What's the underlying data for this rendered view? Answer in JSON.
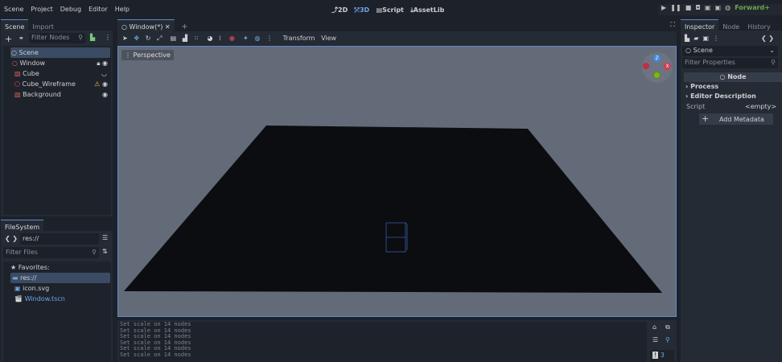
{
  "menu": [
    "Scene",
    "Project",
    "Debug",
    "Editor",
    "Help"
  ],
  "modes": [
    {
      "label": "2D",
      "icon": "2d-icon"
    },
    {
      "label": "3D",
      "icon": "3d-icon",
      "active": true
    },
    {
      "label": "Script",
      "icon": "script-icon"
    },
    {
      "label": "AssetLib",
      "icon": "download-icon"
    }
  ],
  "renderer": "Forward+",
  "scene_dock": {
    "tabs": [
      "Scene",
      "Import"
    ],
    "filter_placeholder": "Filter Nodes",
    "tree": [
      {
        "label": "Scene",
        "icon": "node-icon",
        "selected": true
      },
      {
        "label": "Window",
        "icon": "node-icon",
        "extra": [
          "lock-icon",
          "eye-icon"
        ]
      },
      {
        "label": "Cube",
        "icon": "mesh-icon",
        "extra": [
          "eye-closed-icon"
        ]
      },
      {
        "label": "Cube_Wireframe",
        "icon": "mesh-instance-icon",
        "extra": [
          "warning-icon",
          "eye-icon"
        ]
      },
      {
        "label": "Background",
        "icon": "mesh-icon",
        "extra": [
          "eye-icon"
        ]
      }
    ]
  },
  "filesystem": {
    "tab": "FileSystem",
    "path": "res://",
    "filter_placeholder": "Filter Files",
    "items": [
      {
        "label": "Favorites:",
        "icon": "star-icon"
      },
      {
        "label": "res://",
        "icon": "folder-icon",
        "selected": true
      },
      {
        "label": "icon.svg",
        "icon": "image-icon"
      },
      {
        "label": "Window.tscn",
        "icon": "scene-icon"
      }
    ]
  },
  "editor": {
    "tab": "Window(*)",
    "toolbar_menus": [
      "Transform",
      "View"
    ],
    "viewport_label": "Perspective",
    "gizmo": {
      "z": "Z",
      "x": "X"
    }
  },
  "output": {
    "lines": [
      "Set scale on 14 nodes",
      "Set scale on 14 nodes",
      "Set scale on 14 nodes",
      "Set scale on 14 nodes",
      "Set scale on 14 nodes",
      "Set scale on 14 nodes"
    ],
    "count": "3"
  },
  "inspector": {
    "tabs": [
      "Inspector",
      "Node",
      "History"
    ],
    "object": "Scene",
    "filter_placeholder": "Filter Properties",
    "section": "Node",
    "groups": [
      "Process",
      "Editor Description"
    ],
    "script_label": "Script",
    "script_value": "<empty>",
    "add_metadata": "Add Metadata"
  },
  "colors": {
    "accent": "#5d8ad0",
    "renderer": "#6aa84f",
    "gizmo_x": "#d23c57",
    "gizmo_y": "#7ab61e",
    "gizmo_z": "#3a8ee6"
  }
}
